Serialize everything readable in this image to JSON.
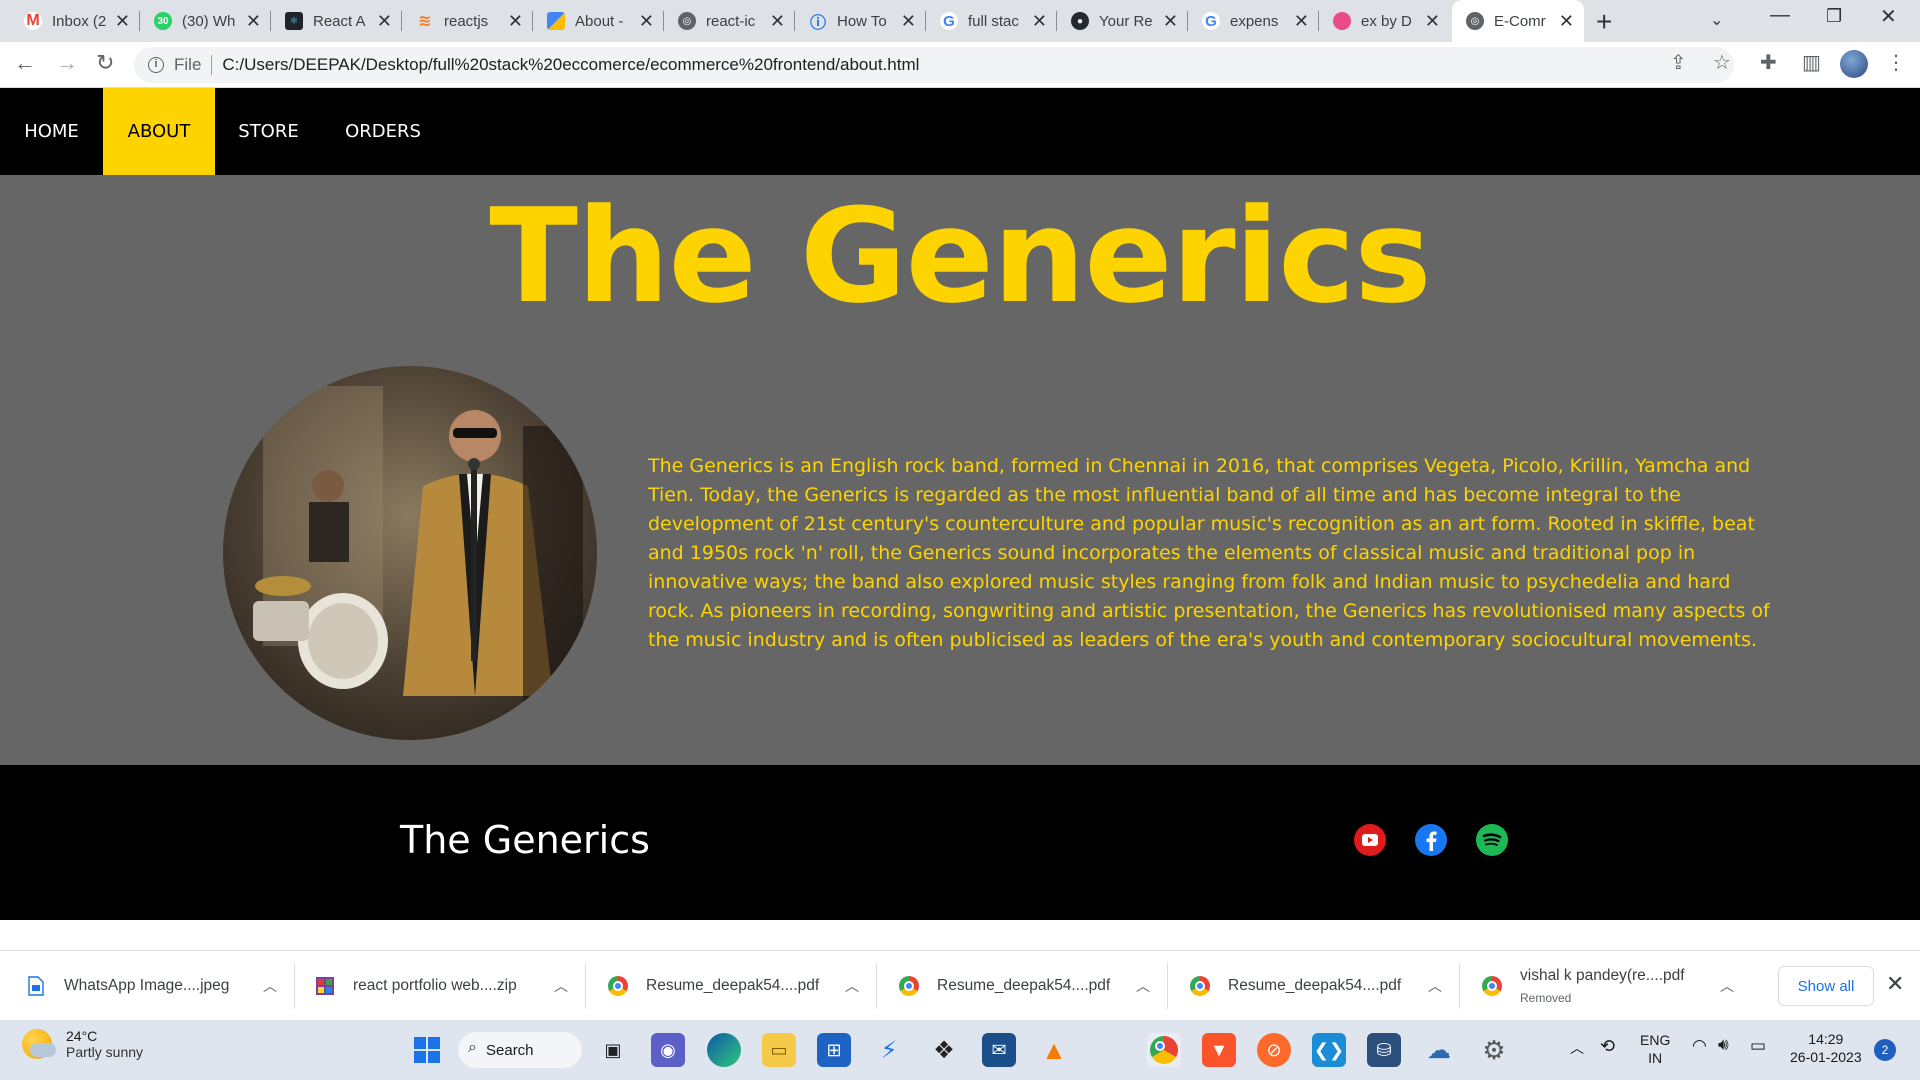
{
  "browser": {
    "tabs": [
      {
        "title": "Inbox (2",
        "icon": "gmail-icon",
        "color": "#ea4335"
      },
      {
        "title": "(30) Wh",
        "icon": "whatsapp-icon",
        "color": "#25d366"
      },
      {
        "title": "React A",
        "icon": "react-icon",
        "color": "#20232a"
      },
      {
        "title": "reactjs",
        "icon": "stackoverflow-icon",
        "color": "#f48024"
      },
      {
        "title": "About -",
        "icon": "google-workspace-icon",
        "color": "#4285f4"
      },
      {
        "title": "react-ic",
        "icon": "globe-icon",
        "color": "#5f6368"
      },
      {
        "title": "How To",
        "icon": "page-icon",
        "color": "#1a73e8"
      },
      {
        "title": "full stac",
        "icon": "google-icon",
        "color": "#4285f4"
      },
      {
        "title": "Your Re",
        "icon": "github-icon",
        "color": "#24292f"
      },
      {
        "title": "expens",
        "icon": "google-icon",
        "color": "#4285f4"
      },
      {
        "title": "ex by D",
        "icon": "dribbble-icon",
        "color": "#ea4c89"
      },
      {
        "title": "E-Comr",
        "icon": "globe-icon",
        "color": "#5f6368"
      }
    ],
    "address": {
      "scheme_label": "File",
      "url": "C:/Users/DEEPAK/Desktop/full%20stack%20eccomerce/ecommerce%20frontend/about.html"
    }
  },
  "page": {
    "nav": [
      "HOME",
      "ABOUT",
      "STORE",
      "ORDERS"
    ],
    "active_nav": "ABOUT",
    "title": "The Generics",
    "about_text": "The Generics is an English rock band, formed in Chennai in 2016, that comprises Vegeta, Picolo, Krillin, Yamcha and Tien. Today, the Generics is regarded as the most influential band of all time and has become integral to the development of 21st century's counterculture and popular music's recognition as an art form. Rooted in skiffle, beat and 1950s rock 'n' roll, the Generics sound incorporates the elements of classical music and traditional pop in innovative ways; the band also explored music styles ranging from folk and Indian music to psychedelia and hard rock. As pioneers in recording, songwriting and artistic presentation, the Generics has revolutionised many aspects of the music industry and is often publicised as leaders of the era's youth and contemporary sociocultural movements.",
    "footer_brand": "The Generics",
    "social": [
      {
        "icon": "youtube-icon",
        "color": "#e01b1b"
      },
      {
        "icon": "facebook-icon",
        "color": "#1877f2"
      },
      {
        "icon": "spotify-icon",
        "color": "#1db954"
      }
    ],
    "accent": "#fdd400",
    "background": "#666666"
  },
  "downloads": [
    {
      "name": "WhatsApp Image....jpeg",
      "icon": "image-file-icon"
    },
    {
      "name": "react portfolio web....zip",
      "icon": "zip-file-icon"
    },
    {
      "name": "Resume_deepak54....pdf",
      "icon": "chrome-icon"
    },
    {
      "name": "Resume_deepak54....pdf",
      "icon": "chrome-icon"
    },
    {
      "name": "Resume_deepak54....pdf",
      "icon": "chrome-icon"
    },
    {
      "name": "vishal k pandey(re....pdf",
      "sub": "Removed",
      "icon": "chrome-icon"
    }
  ],
  "downloads_show_all": "Show all",
  "taskbar": {
    "weather_temp": "24°C",
    "weather_desc": "Partly sunny",
    "search_label": "Search",
    "language": "ENG",
    "region": "IN",
    "time": "14:29",
    "date": "26-01-2023",
    "notifications": "2"
  }
}
